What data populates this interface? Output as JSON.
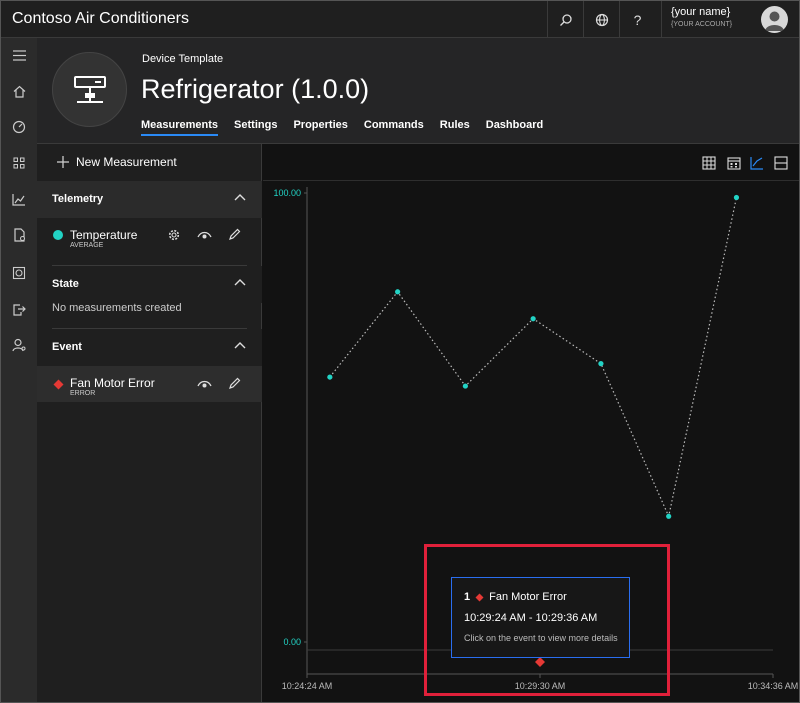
{
  "app": {
    "title": "Contoso Air Conditioners"
  },
  "account": {
    "name": "{your name}",
    "label": "{YOUR ACCOUNT}"
  },
  "topbar_icons": [
    "search-icon",
    "globe-icon",
    "help-icon"
  ],
  "help_glyph": "?",
  "header": {
    "template_label": "Device Template",
    "title": "Refrigerator",
    "version": "(1.0.0)",
    "tabs": [
      {
        "label": "Measurements",
        "active": true
      },
      {
        "label": "Settings"
      },
      {
        "label": "Properties"
      },
      {
        "label": "Commands"
      },
      {
        "label": "Rules"
      },
      {
        "label": "Dashboard"
      }
    ]
  },
  "panel": {
    "new_measurement": "New Measurement",
    "telemetry": {
      "title": "Telemetry",
      "items": [
        {
          "name": "Temperature",
          "sub": "AVERAGE",
          "color": "#22d3c5"
        }
      ]
    },
    "state": {
      "title": "State",
      "empty": "No measurements created"
    },
    "event": {
      "title": "Event",
      "items": [
        {
          "name": "Fan Motor Error",
          "sub": "ERROR",
          "color": "#e53935"
        }
      ]
    }
  },
  "chart_data": {
    "type": "line",
    "series": [
      {
        "name": "Temperature",
        "color": "#22d3c5",
        "style": "dotted",
        "x": [
          "10:24:54 AM",
          "10:26:23 AM",
          "10:27:52 AM",
          "10:29:21 AM",
          "10:30:50 AM",
          "10:32:19 AM",
          "10:33:48 AM"
        ],
        "values": [
          59,
          78,
          57,
          72,
          62,
          28,
          99
        ]
      }
    ],
    "ylim": [
      0,
      100
    ],
    "y_ticks": [
      "100.00",
      "0.00"
    ],
    "x_ticks": [
      "10:24:24 AM",
      "10:29:30 AM",
      "10:34:36 AM"
    ],
    "events": [
      {
        "name": "Fan Motor Error",
        "time": "10:29:30 AM",
        "color": "#e53935"
      }
    ]
  },
  "tooltip": {
    "count": "1",
    "event_name": "Fan Motor Error",
    "time_range": "10:29:24 AM - 10:29:36 AM",
    "hint": "Click on the event to view more details"
  },
  "colors": {
    "accent": "#2a8af6",
    "highlight": "#e0203a",
    "telemetry": "#22d3c5",
    "event": "#e53935"
  }
}
